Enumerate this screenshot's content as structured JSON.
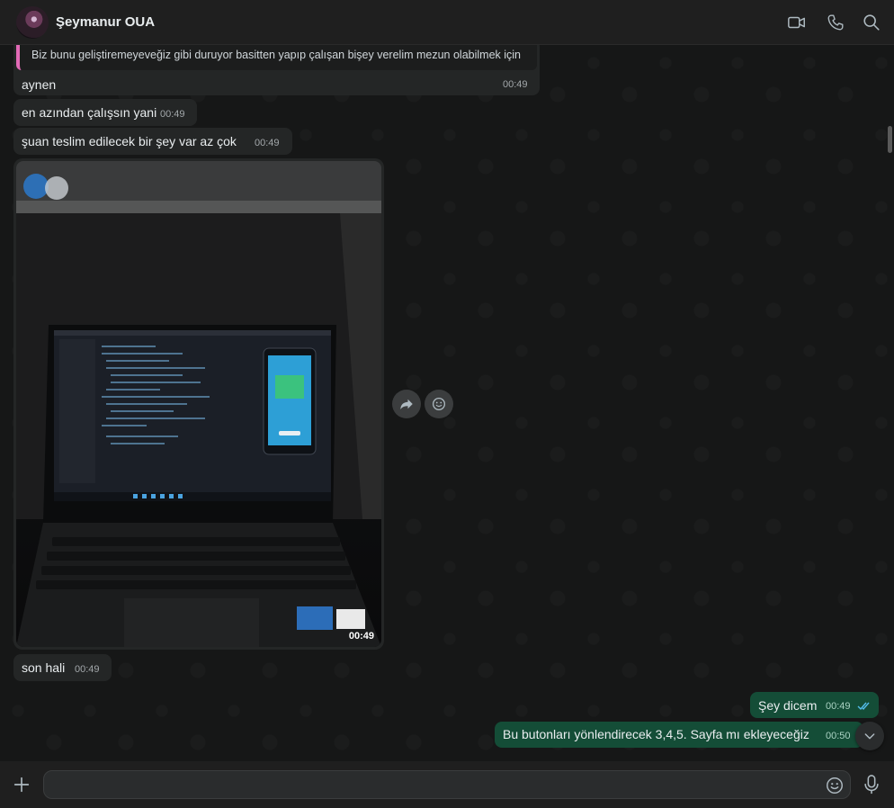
{
  "header": {
    "contact_name": "Şeymanur OUA",
    "avatar_icon": "avatar-icon",
    "video_call_icon": "video-camera-icon",
    "voice_call_icon": "phone-icon",
    "search_icon": "search-icon"
  },
  "messages": [
    {
      "quote": "Biz bunu geliştiremeyeveğiz gibi duruyor basitten yapıp çalışan bişey verelim mezun olabilmek için",
      "text": "aynen",
      "time": "00:49",
      "direction": "in"
    },
    {
      "text": "en azından çalışsın yani",
      "time": "00:49",
      "direction": "in"
    },
    {
      "text": "şuan teslim edilecek bir şey var az çok",
      "time": "00:49",
      "direction": "in"
    },
    {
      "type": "photo",
      "time": "00:49",
      "direction": "in"
    },
    {
      "text": "son hali",
      "time": "00:49",
      "direction": "in"
    },
    {
      "text": "Şey dicem",
      "time": "00:49",
      "direction": "out",
      "status": "read"
    },
    {
      "text": "Bu butonları yönlendirecek 3,4,5. Sayfa mı ekleyeceğiz",
      "time": "00:50",
      "direction": "out"
    }
  ],
  "footer": {
    "placeholder": "",
    "add_icon": "plus-icon",
    "emoji_icon": "emoji-icon",
    "mic_icon": "microphone-icon"
  },
  "colors": {
    "background": "#161717",
    "header": "#1f1f1f",
    "incoming_bubble": "#242626",
    "outgoing_bubble": "#144d37",
    "quote_bar": "#e26ab6",
    "read_tick": "#53bdeb"
  }
}
